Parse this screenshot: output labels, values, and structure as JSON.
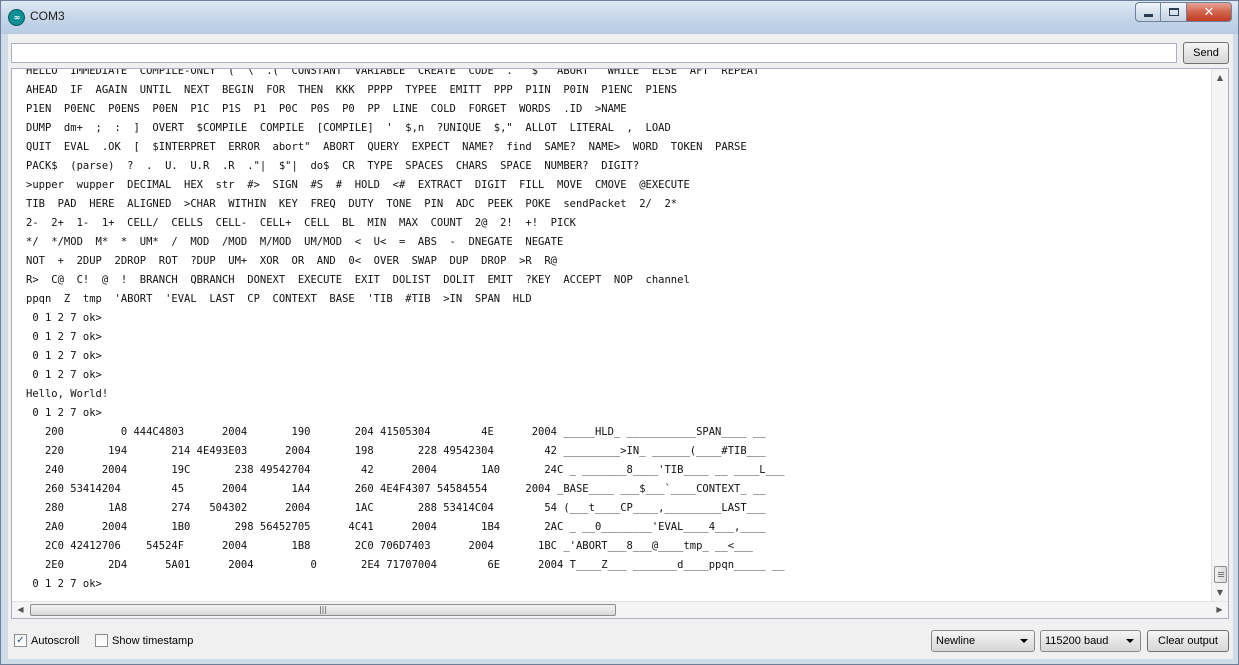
{
  "window": {
    "title": "COM3",
    "icon_text": "∞"
  },
  "send": {
    "input_value": "",
    "button_label": "Send"
  },
  "output_lines": [
    "HELLO  IMMEDIATE  COMPILE-ONLY  (  \\  .(  CONSTANT  VARIABLE  CREATE  CODE  .\"  $\"  ABORT\"  WHILE  ELSE  AFT  REPEAT",
    "AHEAD  IF  AGAIN  UNTIL  NEXT  BEGIN  FOR  THEN  KKK  PPPP  TYPEE  EMITT  PPP  P1IN  P0IN  P1ENC  P1ENS",
    "P1EN  P0ENC  P0ENS  P0EN  P1C  P1S  P1  P0C  P0S  P0  PP  LINE  COLD  FORGET  WORDS  .ID  >NAME",
    "DUMP  dm+  ;  :  ]  OVERT  $COMPILE  COMPILE  [COMPILE]  '  $,n  ?UNIQUE  $,\"  ALLOT  LITERAL  ,  LOAD",
    "QUIT  EVAL  .OK  [  $INTERPRET  ERROR  abort\"  ABORT  QUERY  EXPECT  NAME?  find  SAME?  NAME>  WORD  TOKEN  PARSE",
    "PACK$  (parse)  ?  .  U.  U.R  .R  .\"|  $\"|  do$  CR  TYPE  SPACES  CHARS  SPACE  NUMBER?  DIGIT?",
    ">upper  wupper  DECIMAL  HEX  str  #>  SIGN  #S  #  HOLD  <#  EXTRACT  DIGIT  FILL  MOVE  CMOVE  @EXECUTE",
    "TIB  PAD  HERE  ALIGNED  >CHAR  WITHIN  KEY  FREQ  DUTY  TONE  PIN  ADC  PEEK  POKE  sendPacket  2/  2*",
    "2-  2+  1-  1+  CELL/  CELLS  CELL-  CELL+  CELL  BL  MIN  MAX  COUNT  2@  2!  +!  PICK",
    "*/  */MOD  M*  *  UM*  /  MOD  /MOD  M/MOD  UM/MOD  <  U<  =  ABS  -  DNEGATE  NEGATE",
    "NOT  +  2DUP  2DROP  ROT  ?DUP  UM+  XOR  OR  AND  0<  OVER  SWAP  DUP  DROP  >R  R@",
    "R>  C@  C!  @  !  BRANCH  QBRANCH  DONEXT  EXECUTE  EXIT  DOLIST  DOLIT  EMIT  ?KEY  ACCEPT  NOP  channel",
    "ppqn  Z  tmp  'ABORT  'EVAL  LAST  CP  CONTEXT  BASE  'TIB  #TIB  >IN  SPAN  HLD",
    " 0 1 2 7 ok>",
    " 0 1 2 7 ok>",
    " 0 1 2 7 ok>",
    " 0 1 2 7 ok>",
    "Hello, World!",
    " 0 1 2 7 ok>",
    "   200         0 444C4803      2004       190       204 41505304        4E      2004 _____HLD_ ___________SPAN____ __",
    "   220       194       214 4E493E03      2004       198       228 49542304        42 _________>IN_ ______(____#TIB___",
    "   240      2004       19C       238 49542704        42      2004       1A0       24C _ _______8____'TIB____ __ ____L___",
    "   260 53414204        45      2004       1A4       260 4E4F4307 54584554      2004 _BASE____ ___$___`____CONTEXT_ __",
    "   280       1A8       274   504302      2004       1AC       288 53414C04        54 (___t____CP____,_________LAST___",
    "   2A0      2004       1B0       298 56452705      4C41      2004       1B4       2AC _ __0________'EVAL____4___,____",
    "   2C0 42412706    54524F      2004       1B8       2C0 706D7403      2004       1BC _'ABORT___8___@____tmp_ __<___",
    "   2E0       2D4      5A01      2004         0       2E4 71707004        6E      2004 T____Z___ _______d____ppqn_____ __",
    " 0 1 2 7 ok>"
  ],
  "footer": {
    "autoscroll_label": "Autoscroll",
    "autoscroll_checked": true,
    "timestamp_label": "Show timestamp",
    "timestamp_checked": false,
    "line_ending": "Newline",
    "baud_rate": "115200 baud",
    "clear_label": "Clear output"
  }
}
